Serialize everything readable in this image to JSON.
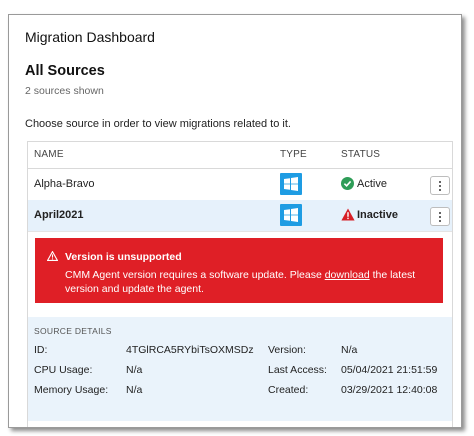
{
  "header": {
    "title": "Migration Dashboard",
    "section_title": "All Sources",
    "count_text": "2 sources shown",
    "instruction": "Choose source in order to view migrations related to it."
  },
  "table": {
    "columns": [
      "NAME",
      "TYPE",
      "STATUS"
    ],
    "rows": [
      {
        "name": "Alpha-Bravo",
        "type_icon": "windows-icon",
        "status": "Active",
        "status_icon": "check-circle-icon",
        "status_color": "#2e9d57"
      },
      {
        "name": "April2021",
        "type_icon": "windows-icon",
        "status": "Inactive",
        "status_icon": "warning-triangle-icon",
        "status_color": "#d71f26"
      }
    ]
  },
  "error": {
    "title": "Version is unsupported",
    "message_before": "CMM Agent version requires a software update. Please ",
    "link_text": "download",
    "message_after": " the latest version and update the agent.",
    "background": "#df1f26"
  },
  "details": {
    "heading": "SOURCE DETAILS",
    "id_label": "ID:",
    "id_value": "4TGlRCA5RYbiTsOXMSDz",
    "cpu_label": "CPU Usage:",
    "cpu_value": "N/a",
    "memory_label": "Memory Usage:",
    "memory_value": "N/a",
    "version_label": "Version:",
    "version_value": "N/a",
    "last_access_label": "Last Access:",
    "last_access_value": "05/04/2021 21:51:59",
    "created_label": "Created:",
    "created_value": "03/29/2021 12:40:08"
  },
  "colors": {
    "accent": "#1e9ce3",
    "selected_row": "#e6f1fb"
  }
}
